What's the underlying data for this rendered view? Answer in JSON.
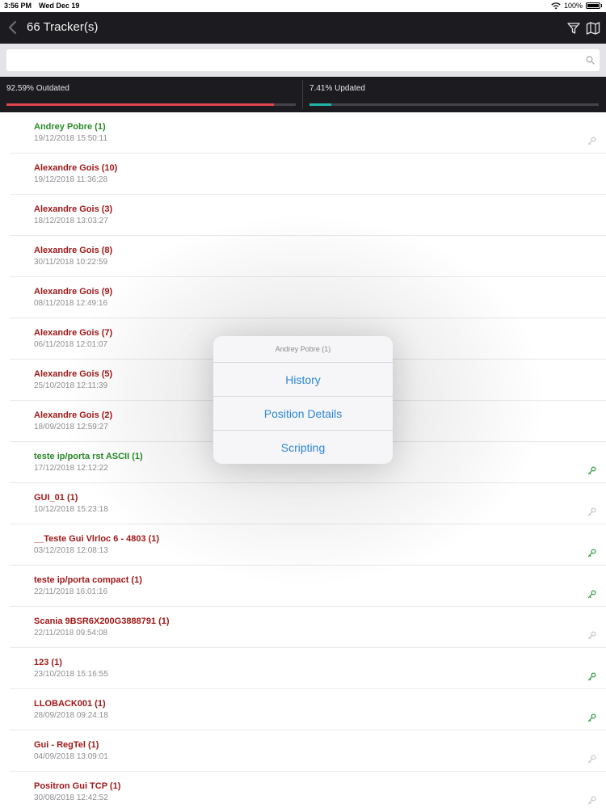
{
  "status_bar": {
    "time": "3:56 PM",
    "date": "Wed Dec 19",
    "battery": "100%"
  },
  "nav": {
    "title": "66 Tracker(s)"
  },
  "search": {
    "value": "",
    "placeholder": ""
  },
  "stats": {
    "outdated": {
      "label": "92.59% Outdated",
      "percent": 92.59,
      "color": "#e0464e"
    },
    "updated": {
      "label": "7.41% Updated",
      "percent": 7.41,
      "color": "#1fb5a8"
    }
  },
  "colors": {
    "online": "#2a8a2a",
    "offline": "#a01818",
    "key_active": "#3aa04a",
    "key_inactive": "#c8c8cc"
  },
  "trackers": [
    {
      "name": "Andrey Pobre (1)",
      "date": "19/12/2018 15:50:11",
      "status": "online",
      "key": "inactive"
    },
    {
      "name": "Alexandre Gois (10)",
      "date": "19/12/2018 11:36:28",
      "status": "offline",
      "key": "none"
    },
    {
      "name": "Alexandre Gois (3)",
      "date": "18/12/2018 13:03:27",
      "status": "offline",
      "key": "none"
    },
    {
      "name": "Alexandre Gois (8)",
      "date": "30/11/2018 10:22:59",
      "status": "offline",
      "key": "none"
    },
    {
      "name": "Alexandre Gois (9)",
      "date": "08/11/2018 12:49:16",
      "status": "offline",
      "key": "none"
    },
    {
      "name": "Alexandre Gois (7)",
      "date": "06/11/2018 12:01:07",
      "status": "offline",
      "key": "none"
    },
    {
      "name": "Alexandre Gois (5)",
      "date": "25/10/2018 12:11:39",
      "status": "offline",
      "key": "none"
    },
    {
      "name": "Alexandre Gois (2)",
      "date": "18/09/2018 12:59:27",
      "status": "offline",
      "key": "none"
    },
    {
      "name": "teste ip/porta rst ASCII (1)",
      "date": "17/12/2018 12:12:22",
      "status": "online",
      "key": "active"
    },
    {
      "name": "GUI_01 (1)",
      "date": "10/12/2018 15:23:18",
      "status": "offline",
      "key": "inactive"
    },
    {
      "name": "__Teste Gui Vlrloc 6 - 4803 (1)",
      "date": "03/12/2018 12:08:13",
      "status": "offline",
      "key": "active"
    },
    {
      "name": "teste ip/porta compact (1)",
      "date": "22/11/2018 16:01:16",
      "status": "offline",
      "key": "active"
    },
    {
      "name": "Scania 9BSR6X200G3888791 (1)",
      "date": "22/11/2018 09:54:08",
      "status": "offline",
      "key": "inactive"
    },
    {
      "name": "123 (1)",
      "date": "23/10/2018 15:16:55",
      "status": "offline",
      "key": "active"
    },
    {
      "name": "LLOBACK001 (1)",
      "date": "28/09/2018 09:24:18",
      "status": "offline",
      "key": "active"
    },
    {
      "name": "Gui - RegTel (1)",
      "date": "04/09/2018 13:09:01",
      "status": "offline",
      "key": "inactive"
    },
    {
      "name": "Positron Gui TCP (1)",
      "date": "30/08/2018 12:42:52",
      "status": "offline",
      "key": "inactive"
    }
  ],
  "action_sheet": {
    "title": "Andrey Pobre (1)",
    "options": [
      "History",
      "Position Details",
      "Scripting"
    ]
  }
}
